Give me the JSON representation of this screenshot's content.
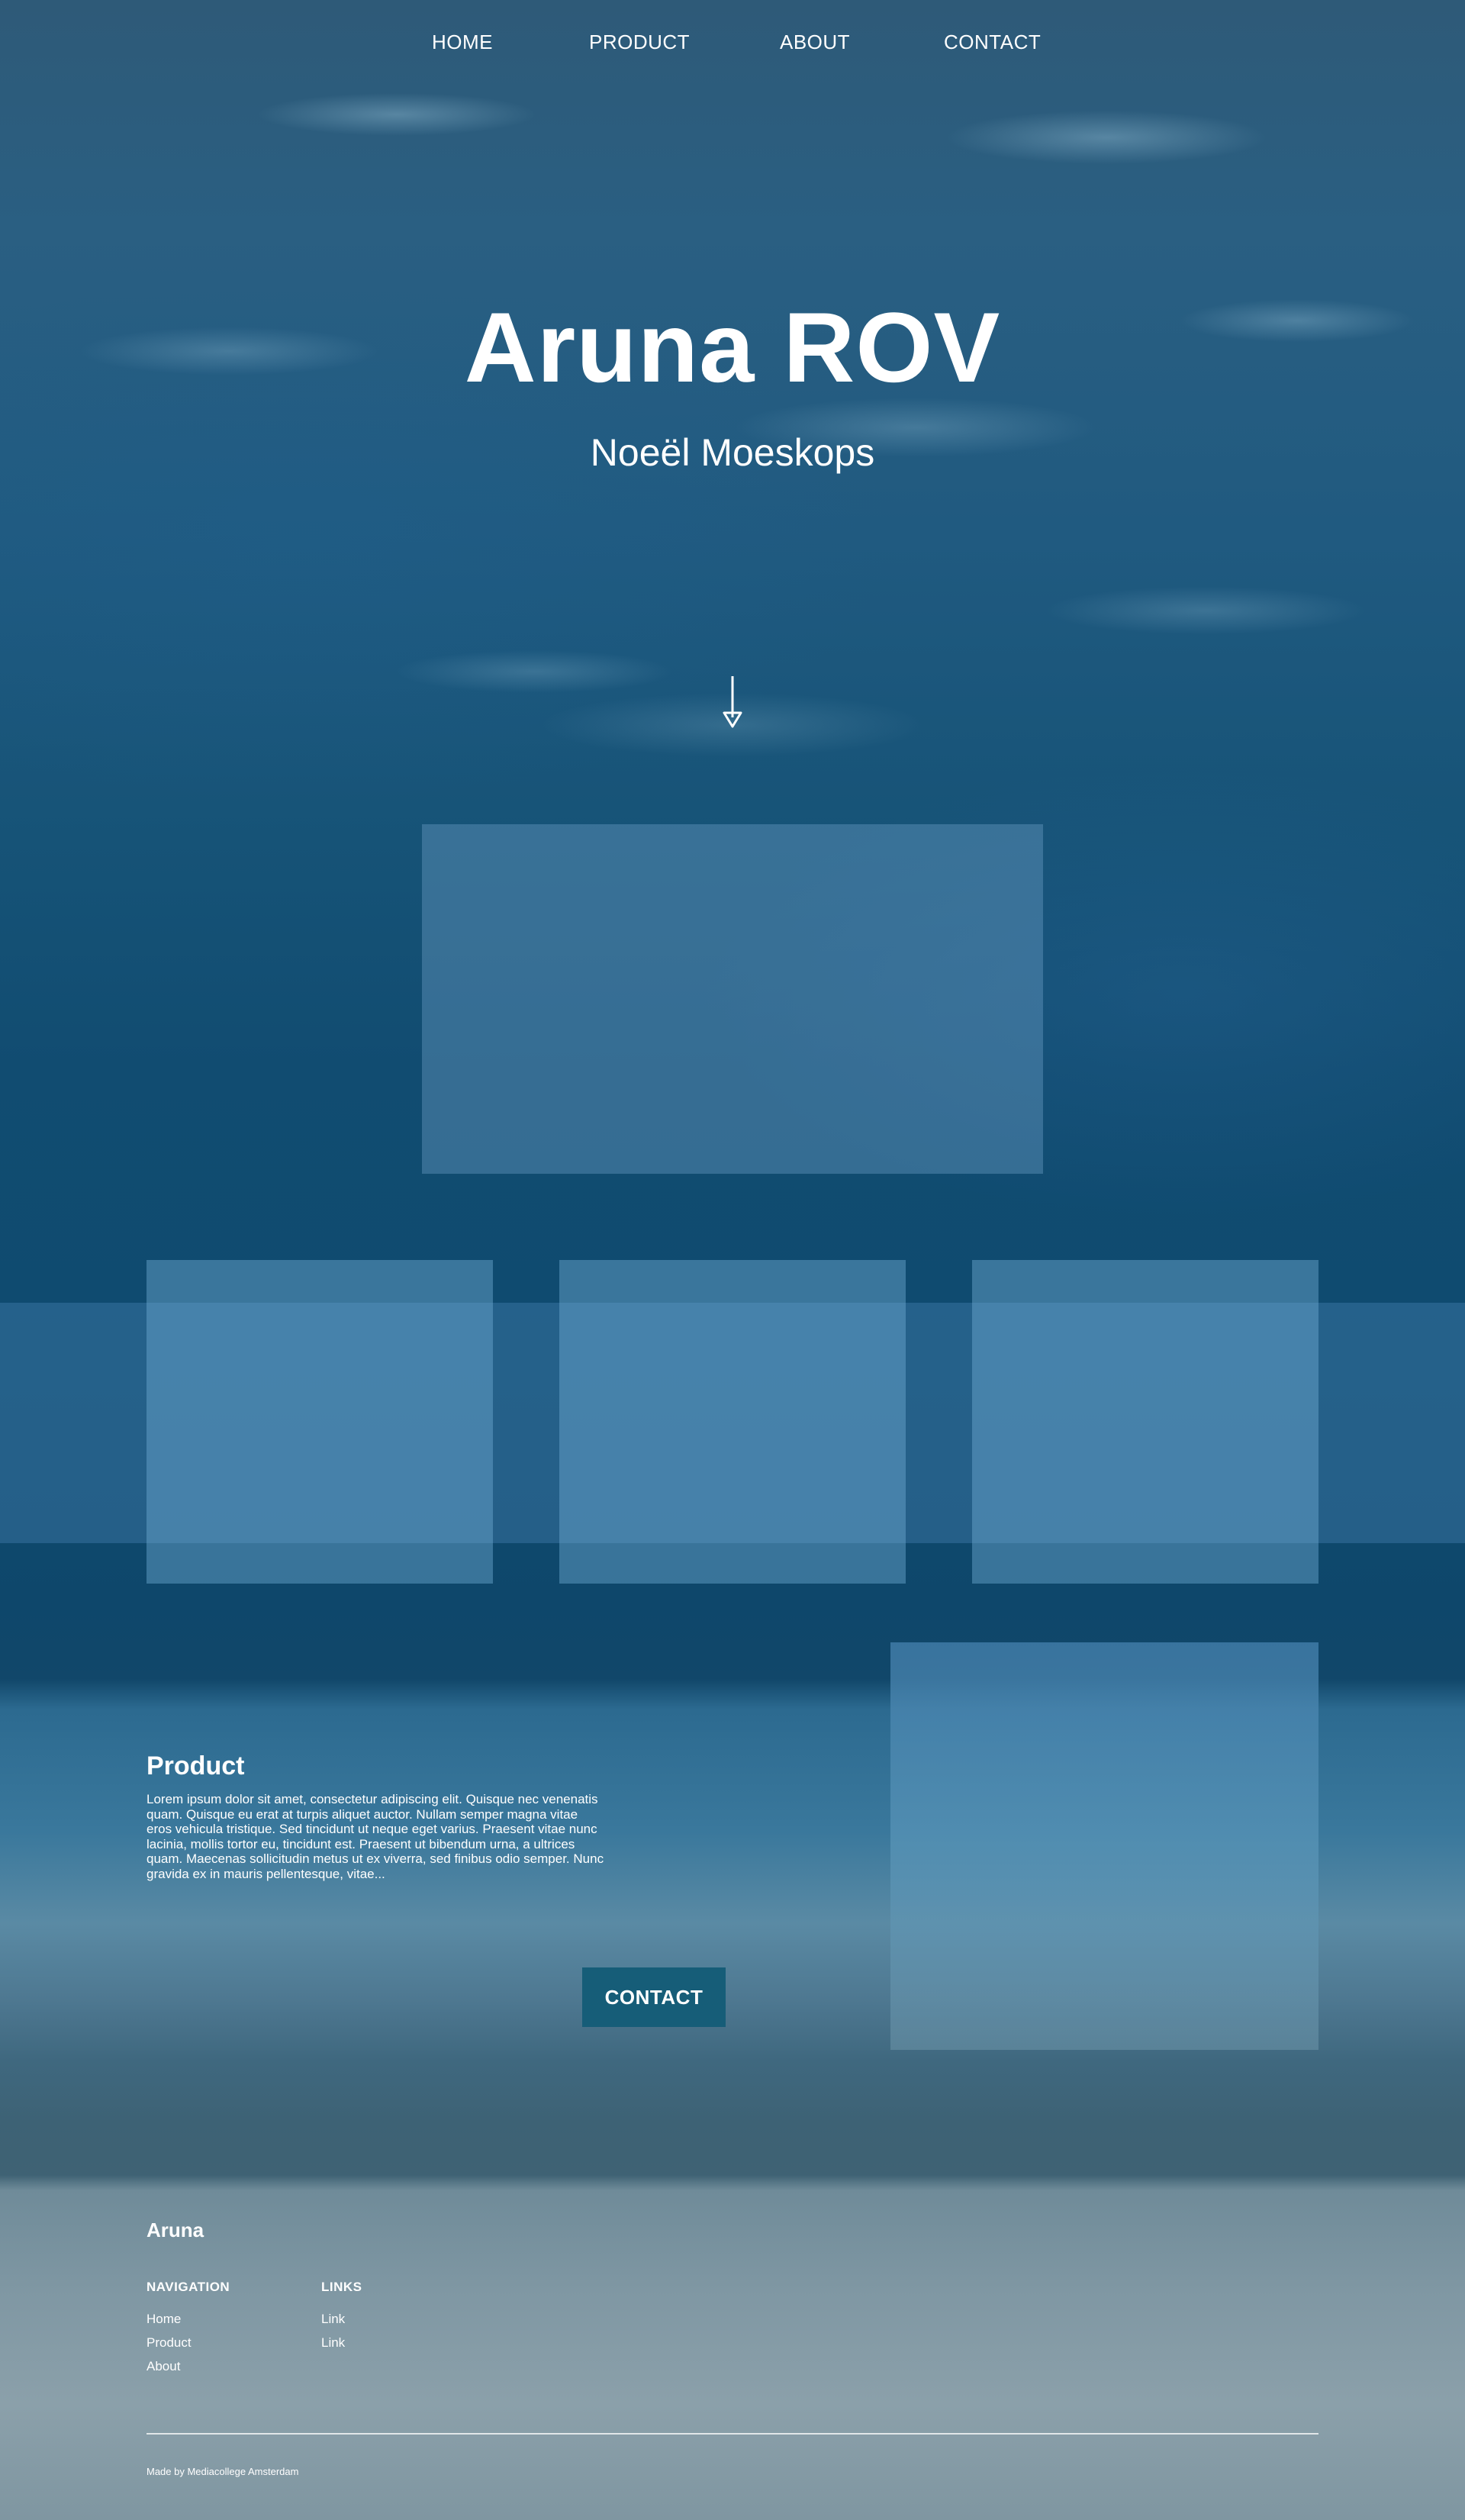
{
  "nav": {
    "items": [
      {
        "label": "HOME"
      },
      {
        "label": "PRODUCT"
      },
      {
        "label": "ABOUT"
      },
      {
        "label": "CONTACT"
      }
    ]
  },
  "hero": {
    "title": "Aruna ROV",
    "subtitle": "Noeël Moeskops",
    "scroll_icon": "arrow-down-icon"
  },
  "product": {
    "title": "Product",
    "text": "Lorem ipsum dolor sit amet, consectetur adipiscing elit. Quisque nec venenatis quam. Quisque eu erat at turpis aliquet auctor. Nullam semper magna vitae eros vehicula tristique. Sed tincidunt ut neque eget varius. Praesent vitae nunc lacinia, mollis tortor eu, tincidunt est. Praesent ut bibendum urna, a ultrices quam. Maecenas sollicitudin metus ut ex viverra, sed finibus odio semper. Nunc gravida ex in mauris pellentesque, vitae...",
    "contact_label": "CONTACT"
  },
  "footer": {
    "brand": "Aruna",
    "navigation": {
      "heading": "NAVIGATION",
      "links": [
        "Home",
        "Product",
        "About"
      ]
    },
    "links": {
      "heading": "LINKS",
      "links": [
        "Link",
        "Link"
      ]
    },
    "credit": "Made by Mediacollege Amsterdam"
  },
  "colors": {
    "button": "#165d78",
    "text": "#ffffff"
  }
}
